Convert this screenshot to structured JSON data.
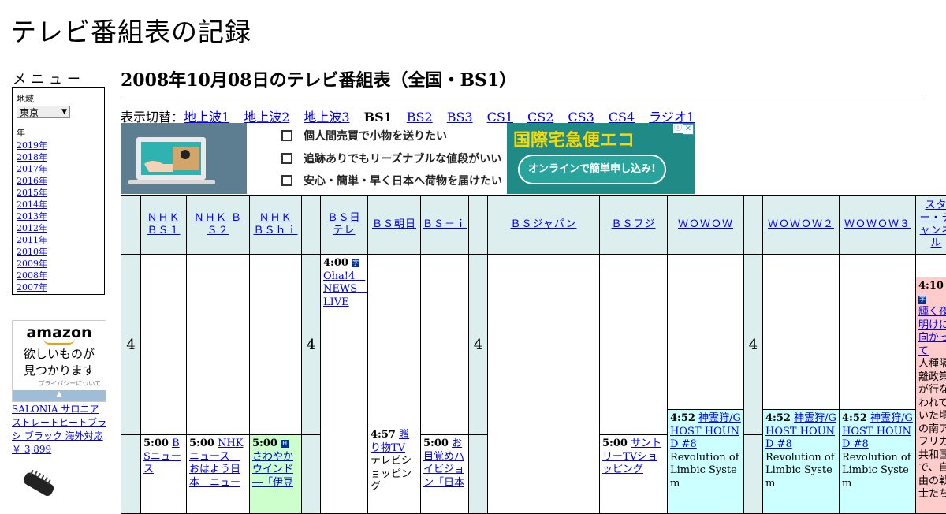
{
  "site_title": "テレビ番組表の記録",
  "sidebar": {
    "menu_label": "メニュー",
    "region_label": "地域",
    "region_value": "東京",
    "year_label": "年",
    "years": [
      "2019年",
      "2018年",
      "2017年",
      "2016年",
      "2015年",
      "2014年",
      "2013年",
      "2012年",
      "2011年",
      "2010年",
      "2009年",
      "2008年",
      "2007年"
    ]
  },
  "amazon_ad": {
    "logo": "amazon",
    "line1": "欲しいものが",
    "line2": "見つかります",
    "privacy": "プライバシーについて"
  },
  "product": {
    "name": "SALONIA サロニア ストレートヒートブラシ ブラック 海外対応",
    "price": "￥ 3,899"
  },
  "page_heading": "2008年10月08日のテレビ番組表（全国・BS1）",
  "switcher": {
    "label": "表示切替：",
    "items": [
      "地上波1",
      "地上波2",
      "地上波3",
      "BS1",
      "BS2",
      "BS3",
      "CS1",
      "CS2",
      "CS3",
      "CS4",
      "ラジオ1"
    ],
    "current": "BS1"
  },
  "banner": {
    "line1": "個人間売買で小物を送りたい",
    "line2": "追跡ありでもリーズナブルな値段がいい",
    "line3": "安心・簡単・早く日本へ荷物を届けたい",
    "brand": "国際宅急便エコ",
    "cta": "オンラインで簡単申し込み!"
  },
  "channels": [
    "ＮＨＫ ＢＳ１",
    "ＮＨＫ ＢＳ２",
    "ＮＨＫ ＢＳｈｉ",
    "ＢＳ日テレ",
    "ＢＳ朝日",
    "ＢＳ－ｉ",
    "ＢＳジャパン",
    "ＢＳフジ",
    "ＷＯＷＯＷ",
    "ＷＯＷＯＷ２",
    "ＷＯＷＯＷ３",
    "スター・チャンネル"
  ],
  "hour_label": "4",
  "programs": {
    "bs1_500": {
      "time": "5:00",
      "title": "BSニュース"
    },
    "bs2_500": {
      "time": "5:00",
      "title": "NHKニュース　おはよう日本　ニュー"
    },
    "bshi_500": {
      "time": "5:00",
      "title": "さわやかウインド―「伊豆"
    },
    "ntv_400": {
      "time": "4:00",
      "title": "Oha!4　NEWS　LIVE"
    },
    "asahi_457": {
      "time": "4:57",
      "title": "贈り物TV",
      "desc": "テレビショッピング"
    },
    "bsi_500": {
      "time": "5:00",
      "title": "お目覚めハイビジョン「日本"
    },
    "fuji_500": {
      "time": "5:00",
      "title": "サントリーTVショッピング"
    },
    "wowow_452": {
      "time": "4:52",
      "title": "神霊狩/GHOST HOUND #8",
      "desc": "Revolution of Limbic System"
    },
    "wowow2_452": {
      "time": "4:52",
      "title": "神霊狩/GHOST HOUND #8",
      "desc": "Revolution of Limbic System"
    },
    "wowow3_452": {
      "time": "4:52",
      "title": "神霊狩/GHOST HOUND #8",
      "desc": "Revolution of Limbic System"
    },
    "star_410": {
      "time": "4:10",
      "title": "輝く夜明けに向かって",
      "desc": "人種隔離政策が行なわれていた頃の南アフリカ共和国で、自由の戦士たち"
    }
  }
}
